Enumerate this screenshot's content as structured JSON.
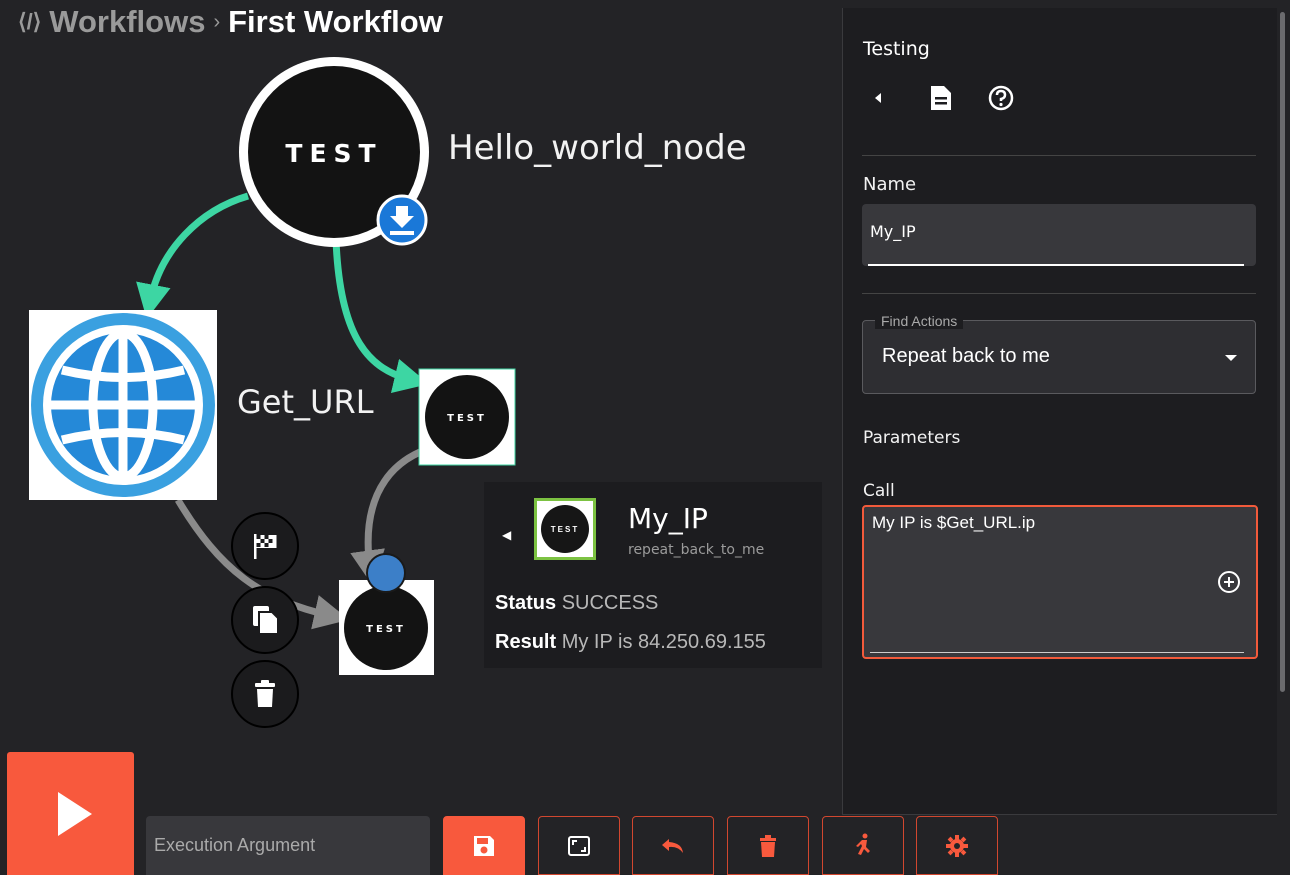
{
  "breadcrumb": {
    "root": "Workflows",
    "separator": "›",
    "current": "First Workflow"
  },
  "canvas": {
    "nodes": [
      {
        "id": "hello",
        "label": "Hello_world_node",
        "logo_text": "TEST",
        "is_start": true
      },
      {
        "id": "get_url",
        "label": "Get_URL"
      },
      {
        "id": "test_mid",
        "logo_text": "TEST"
      },
      {
        "id": "my_ip",
        "logo_text": "TEST",
        "selected": true
      }
    ],
    "node_actions": [
      "flag-icon",
      "copy-icon",
      "trash-icon"
    ]
  },
  "popup": {
    "title": "My_IP",
    "subtitle": "repeat_back_to_me",
    "logo_text": "TEST",
    "status_label": "Status",
    "status_value": "SUCCESS",
    "result_label": "Result",
    "result_value": "My IP is 84.250.69.155"
  },
  "panel": {
    "title": "Testing",
    "name_label": "Name",
    "name_value": "My_IP",
    "find_actions_label": "Find Actions",
    "find_actions_value": "Repeat back to me",
    "parameters_label": "Parameters",
    "call_label": "Call",
    "call_value": "My IP is $Get_URL.ip"
  },
  "toolbar": {
    "execution_placeholder": "Execution Argument",
    "buttons": [
      "save-icon",
      "fullscreen-icon",
      "undo-icon",
      "delete-icon",
      "run-icon",
      "settings-icon"
    ]
  },
  "colors": {
    "accent": "#f8593d",
    "edge_active": "#3dd6a3",
    "edge_inactive": "#8a8a8a",
    "selected_dot": "#3c7fc8"
  }
}
